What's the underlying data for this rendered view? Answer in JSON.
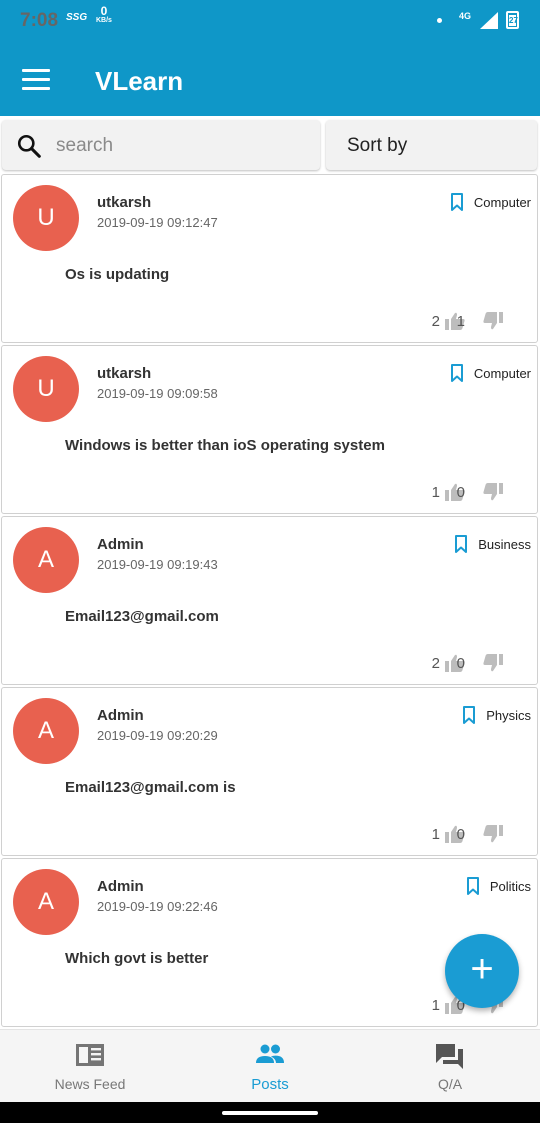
{
  "status_bar": {
    "time": "7:08",
    "indicator": "SSG",
    "net_speed": "0",
    "net_unit": "KB/s",
    "network": "4G",
    "battery": "27"
  },
  "app": {
    "title": "VLearn"
  },
  "search": {
    "placeholder": "search",
    "sort_label": "Sort by"
  },
  "posts": [
    {
      "initial": "U",
      "author": "utkarsh",
      "time": "2019-09-19 09:12:47",
      "category": "Computer",
      "content": "Os is updating",
      "likes": "2",
      "dislikes": "1"
    },
    {
      "initial": "U",
      "author": "utkarsh",
      "time": "2019-09-19 09:09:58",
      "category": "Computer",
      "content": "Windows is better than ioS operating system",
      "likes": "1",
      "dislikes": "0"
    },
    {
      "initial": "A",
      "author": "Admin",
      "time": "2019-09-19 09:19:43",
      "category": "Business",
      "content": "Email123@gmail.com",
      "likes": "2",
      "dislikes": "0"
    },
    {
      "initial": "A",
      "author": "Admin",
      "time": "2019-09-19 09:20:29",
      "category": "Physics",
      "content": "Email123@gmail.com is",
      "likes": "1",
      "dislikes": "0"
    },
    {
      "initial": "A",
      "author": "Admin",
      "time": "2019-09-19 09:22:46",
      "category": "Politics",
      "content": "Which govt is better",
      "likes": "1",
      "dislikes": "0"
    }
  ],
  "fab": {
    "icon": "plus-icon",
    "label": "+"
  },
  "bottom_nav": [
    {
      "label": "News Feed",
      "icon": "newspaper-icon",
      "active": false
    },
    {
      "label": "Posts",
      "icon": "people-icon",
      "active": true
    },
    {
      "label": "Q/A",
      "icon": "forum-icon",
      "active": false
    }
  ],
  "colors": {
    "primary": "#0f97c8",
    "accent": "#1a9cd3",
    "avatar": "#e8614f"
  }
}
